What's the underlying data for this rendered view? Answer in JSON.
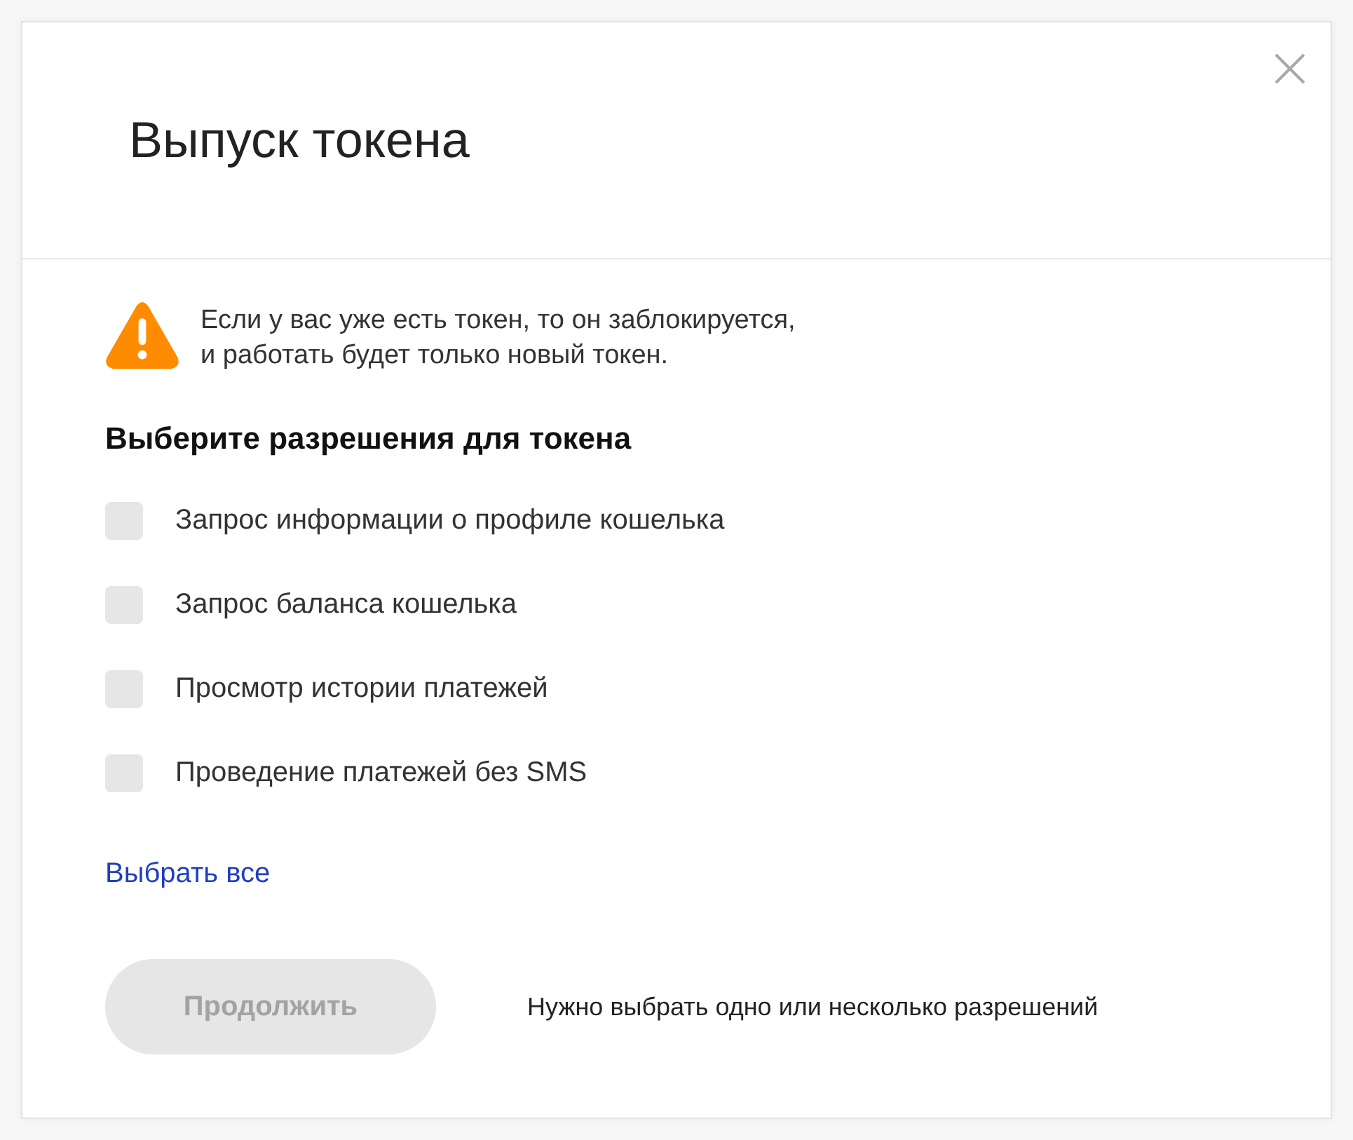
{
  "dialog": {
    "title": "Выпуск токена",
    "warning": "Если у вас уже есть токен, то он заблокируется,\nи работать будет только новый токен.",
    "permissions_heading": "Выберите разрешения для токена",
    "permissions": [
      {
        "label": "Запрос информации о профиле кошелька",
        "checked": false
      },
      {
        "label": "Запрос баланса кошелька",
        "checked": false
      },
      {
        "label": "Просмотр истории платежей",
        "checked": false
      },
      {
        "label": "Проведение платежей без SMS",
        "checked": false
      }
    ],
    "select_all": "Выбрать все",
    "continue_button": {
      "label": "Продолжить",
      "disabled": true
    },
    "hint": "Нужно выбрать одно или несколько разрешений"
  }
}
